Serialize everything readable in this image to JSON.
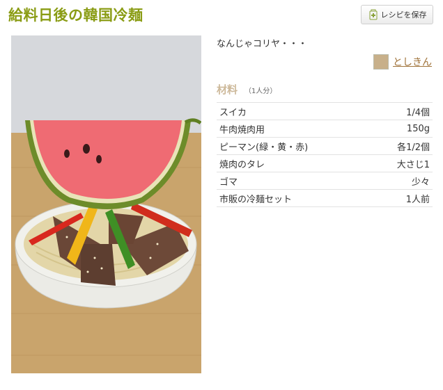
{
  "recipe": {
    "title": "給料日後の韓国冷麺",
    "description": "なんじゃコリヤ・・・",
    "author": "としきん"
  },
  "toolbar": {
    "save_label": "レシピを保存"
  },
  "ingredients": {
    "heading": "材料",
    "servings": "（1人分）",
    "items": [
      {
        "name": "スイカ",
        "amount": "1/4個"
      },
      {
        "name": "牛肉焼肉用",
        "amount": "150g"
      },
      {
        "name": "ピーマン(緑・黄・赤)",
        "amount": "各1/2個"
      },
      {
        "name": "焼肉のタレ",
        "amount": "大さじ1"
      },
      {
        "name": "ゴマ",
        "amount": "少々"
      },
      {
        "name": "市販の冷麺セット",
        "amount": "1人前"
      }
    ]
  },
  "colors": {
    "title": "#8a9c14",
    "ingredients_heading": "#cdb99a",
    "author_link": "#a0733a"
  },
  "icons": {
    "save": "bookmark-plus-icon",
    "avatar": "user-avatar"
  }
}
